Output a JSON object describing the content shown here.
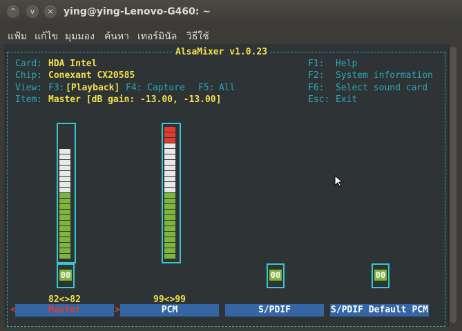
{
  "window": {
    "title": "ying@ying-Lenovo-G460: ~",
    "buttons": [
      "^",
      "v",
      "×"
    ]
  },
  "menu": [
    "แฟ้ม",
    "แก้ไข",
    "มุมมอง",
    "ค้นหา",
    "เทอร์มินัล",
    "วิธีใช้"
  ],
  "mixer": {
    "header": "AlsaMixer v1.0.23",
    "card_label": "Card:",
    "card_value": "HDA Intel",
    "chip_label": "Chip:",
    "chip_value": "Conexant CX20585",
    "view_label": "View:",
    "view_f3": "F3:",
    "view_playback": "[Playback]",
    "view_f4": "F4:",
    "view_capture": "Capture",
    "view_f5": "F5:",
    "view_all": "All",
    "item_label": "Item:",
    "item_value": "Master [dB gain: -13.00, -13.00]",
    "help": [
      {
        "key": "F1:",
        "text": "Help"
      },
      {
        "key": "F2:",
        "text": "System information"
      },
      {
        "key": "F6:",
        "text": "Select sound card"
      },
      {
        "key": "Esc:",
        "text": "Exit"
      }
    ],
    "channels": [
      {
        "name": "Master",
        "value_text": "82<>82",
        "mute": "00",
        "level": 0.82,
        "selected": true
      },
      {
        "name": "PCM",
        "value_text": "99<>99",
        "mute": "00",
        "level": 0.99,
        "selected": false
      },
      {
        "name": "S/PDIF",
        "value_text": "",
        "mute": "00",
        "level": null,
        "selected": false
      },
      {
        "name": "S/PDIF Default PCM",
        "value_text": "",
        "mute": "00",
        "level": null,
        "selected": false
      }
    ],
    "select_left": "<",
    "select_right": ">"
  },
  "colors": {
    "terminal_bg": "#2e3436",
    "cyan": "#2aa8b4",
    "yellow": "#f2e04a",
    "red": "#e33b2f",
    "green": "#7fb53a",
    "blue": "#3465a4"
  }
}
